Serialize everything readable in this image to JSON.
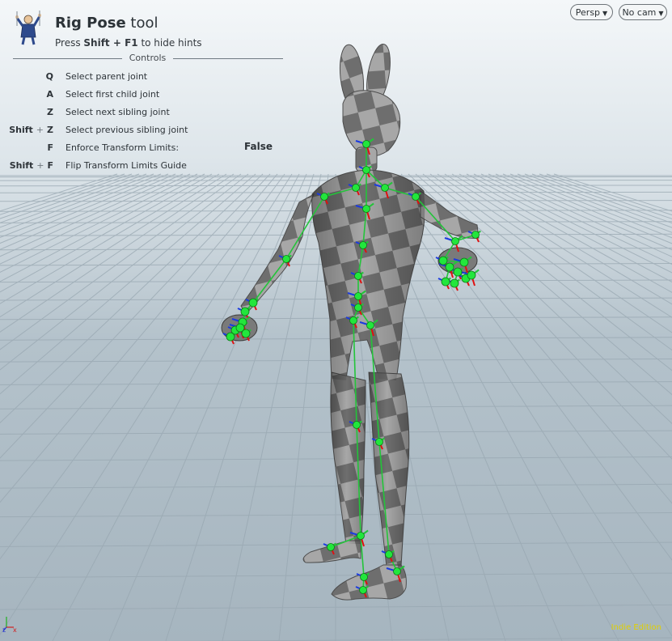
{
  "tool": {
    "icon": "rig-pose-tool-icon",
    "title_bold": "Rig Pose",
    "title_rest": " tool",
    "hint_pre": "Press ",
    "hint_keys": "Shift + F1",
    "hint_post": " to hide hints"
  },
  "controls": {
    "heading": "Controls",
    "rows": [
      {
        "mod": "",
        "key": "Q",
        "desc": "Select parent joint",
        "value": ""
      },
      {
        "mod": "",
        "key": "A",
        "desc": "Select first child joint",
        "value": ""
      },
      {
        "mod": "",
        "key": "Z",
        "desc": "Select next sibling joint",
        "value": ""
      },
      {
        "mod": "Shift",
        "key": "Z",
        "desc": "Select previous sibling joint",
        "value": ""
      },
      {
        "mod": "",
        "key": "F",
        "desc": "Enforce Transform Limits:",
        "value": "False"
      },
      {
        "mod": "Shift",
        "key": "F",
        "desc": "Flip Transform Limits Guide",
        "value": ""
      }
    ]
  },
  "viewport_menu": {
    "persp_label": "Persp",
    "cam_label": "No cam",
    "dropdown_icon": "chevron-down-icon"
  },
  "axes": {
    "x_label": "x",
    "z_label": "z"
  },
  "edition_label": "Indie Edition",
  "colors": {
    "joint_green": "#22e63c",
    "bone_green": "#23c43a",
    "axis_red": "#e01010",
    "axis_blue": "#1a3ae0",
    "edition_yellow": "#e0d000",
    "mesh_dark": "#6f6f6f",
    "mesh_light": "#a9a9a9"
  }
}
